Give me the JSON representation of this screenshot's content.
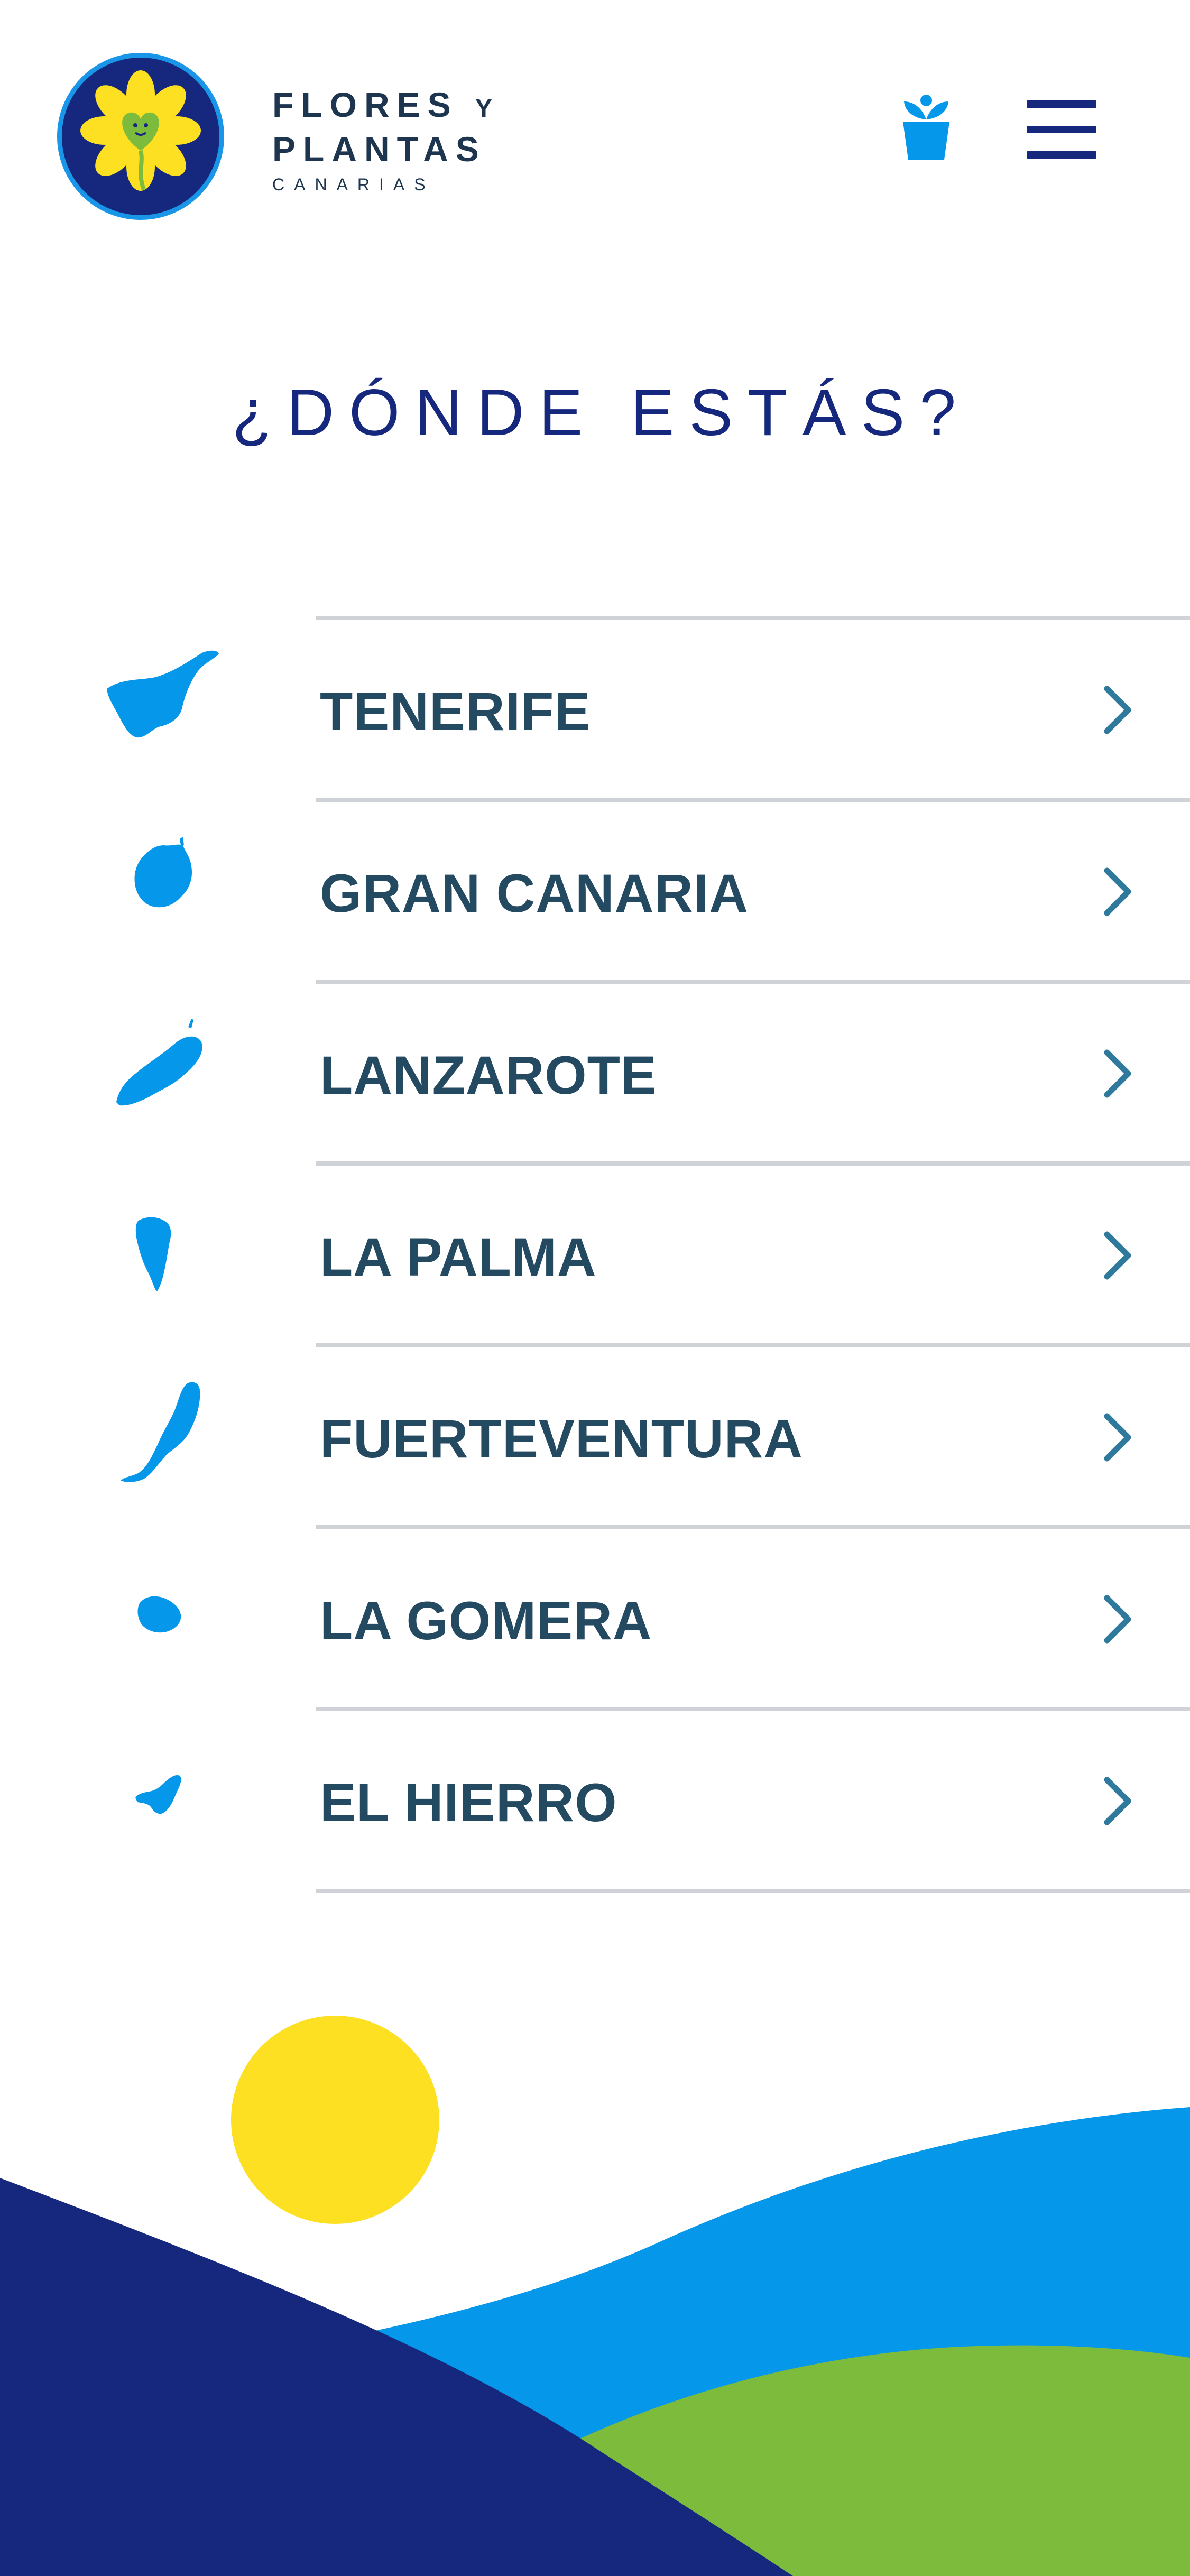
{
  "brand": {
    "line1": "FLORES",
    "line1_small": "Y",
    "line2": "PLANTAS",
    "line3": "CANARIAS"
  },
  "header": {
    "pot_icon": "flower-pot-icon",
    "menu_icon": "hamburger-menu-icon"
  },
  "page": {
    "title": "¿DÓNDE ESTÁS?"
  },
  "islands": [
    {
      "label": "TENERIFE",
      "icon": "tenerife-silhouette-icon"
    },
    {
      "label": "GRAN CANARIA",
      "icon": "gran-canaria-silhouette-icon"
    },
    {
      "label": "LANZAROTE",
      "icon": "lanzarote-silhouette-icon"
    },
    {
      "label": "LA PALMA",
      "icon": "la-palma-silhouette-icon"
    },
    {
      "label": "FUERTEVENTURA",
      "icon": "fuerteventura-silhouette-icon"
    },
    {
      "label": "LA GOMERA",
      "icon": "la-gomera-silhouette-icon"
    },
    {
      "label": "EL HIERRO",
      "icon": "el-hierro-silhouette-icon"
    }
  ],
  "colors": {
    "navy": "#16287e",
    "sky_blue": "#0597ea",
    "green": "#7dbb3c",
    "sun_yellow": "#fce021",
    "text_dark": "#244a62",
    "chevron": "#2f7a9c",
    "divider": "#cfd2d6"
  }
}
